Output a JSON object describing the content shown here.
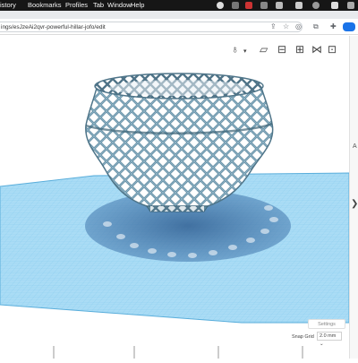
{
  "menubar": {
    "items": [
      "istory",
      "Bookmarks",
      "Profiles",
      "Tab",
      "Window",
      "Help"
    ]
  },
  "address_bar": {
    "url": "ings/esJzeAi2qvr-powerful-hillar-jofo/edit"
  },
  "right_panel": {
    "letter": "A",
    "arrow": "❯"
  },
  "settings": {
    "label": "Settings"
  },
  "snap_grid": {
    "label": "Snap Grid",
    "value": "2.0 mm ⌄"
  },
  "colors": {
    "menubar_bg": "#161616",
    "grid_light": "#a9dcf6",
    "grid_line": "#6bbde8",
    "model": "#6f98ad",
    "model_dark": "#3e6478",
    "shadow": "#4a7fb3"
  }
}
